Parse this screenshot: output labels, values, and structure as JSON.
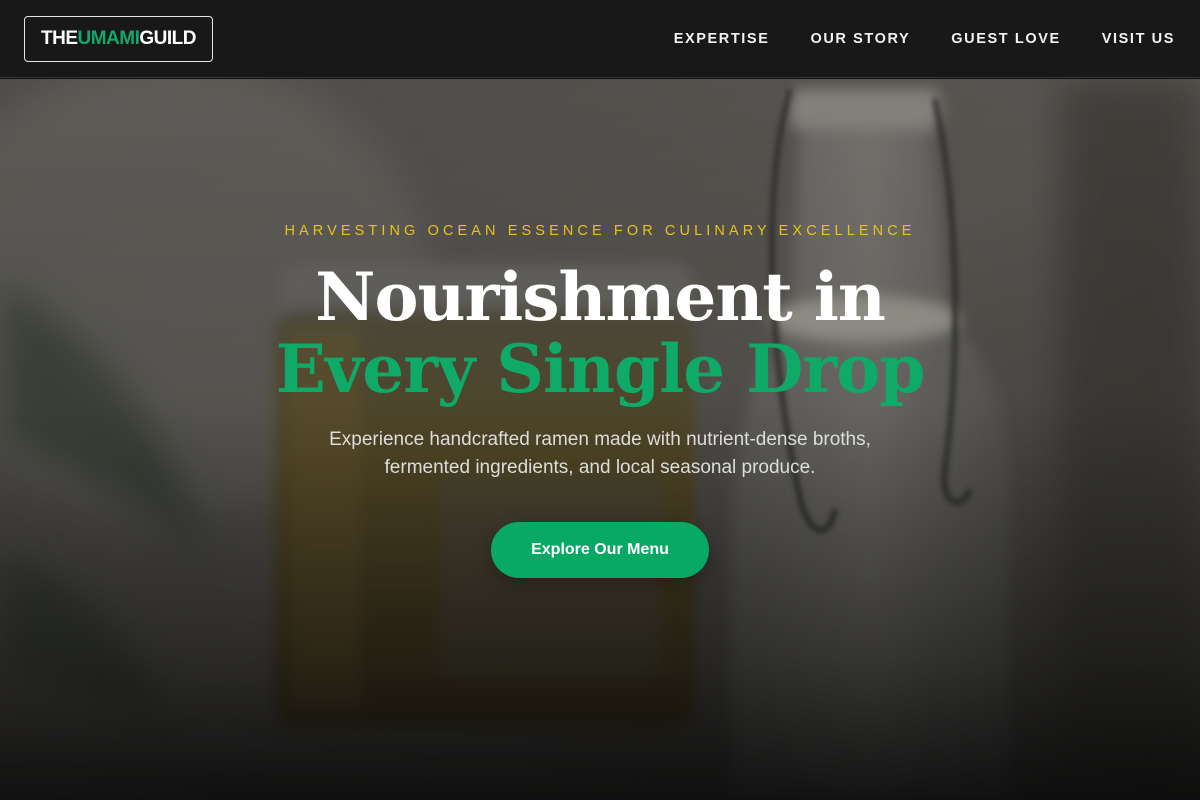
{
  "header": {
    "logo": {
      "part1": "THE ",
      "part2": "UMAMI",
      "part3": " GUILD"
    },
    "nav": [
      {
        "label": "EXPERTISE"
      },
      {
        "label": "OUR STORY"
      },
      {
        "label": "GUEST LOVE"
      },
      {
        "label": "VISIT US"
      }
    ]
  },
  "hero": {
    "tagline": "HARVESTING OCEAN ESSENCE FOR CULINARY EXCELLENCE",
    "headline_line1": "Nourishment in",
    "headline_line2": "Every Single Drop",
    "subtext": "Experience handcrafted ramen made with nutrient-dense broths, fermented ingredients, and local seasonal produce.",
    "cta_label": "Explore Our Menu"
  },
  "colors": {
    "accent_green": "#0fa968",
    "tagline_gold": "#e7c21f",
    "header_bg": "#181818"
  }
}
